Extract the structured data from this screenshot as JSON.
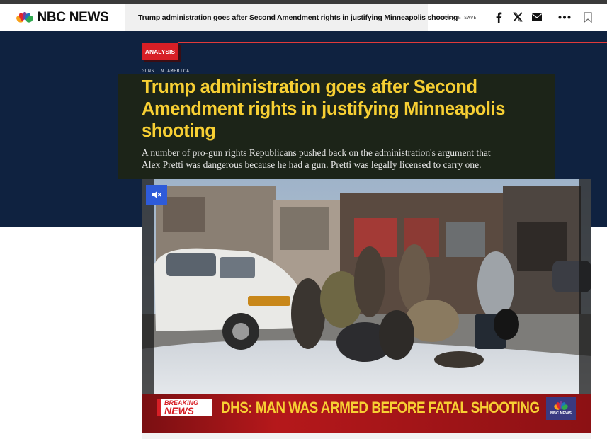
{
  "header": {
    "logo_text": "NBC NEWS",
    "article_title": "Trump administration goes after Second Amendment rights in justifying Minneapolis shooting",
    "share_save": "SHARE & SAVE —",
    "icons": [
      "facebook-icon",
      "x-icon",
      "email-icon",
      "more-icon",
      "bookmark-icon"
    ]
  },
  "article": {
    "badge": "ANALYSIS",
    "section": "GUNS IN AMERICA",
    "headline": "Trump administration goes after Second Amendment rights in justifying Minneapolis shooting",
    "dek": "A number of pro-gun rights Republicans pushed back on the administration's argument that Alex Pretti was dangerous because he had a gun. Pretti was legally licensed to carry one."
  },
  "video": {
    "mute_icon": "muted-speaker-icon",
    "breaking_top": "BREAKING",
    "breaking_bottom": "NEWS",
    "ticker": "DHS: MAN WAS ARMED BEFORE FATAL SHOOTING",
    "corner_logo_text": "NBC NEWS"
  },
  "colors": {
    "hero_bg": "#0f2240",
    "headline_yellow": "#f7cf33",
    "breaking_red": "#d71f26",
    "mute_blue": "#2e5bd9"
  }
}
